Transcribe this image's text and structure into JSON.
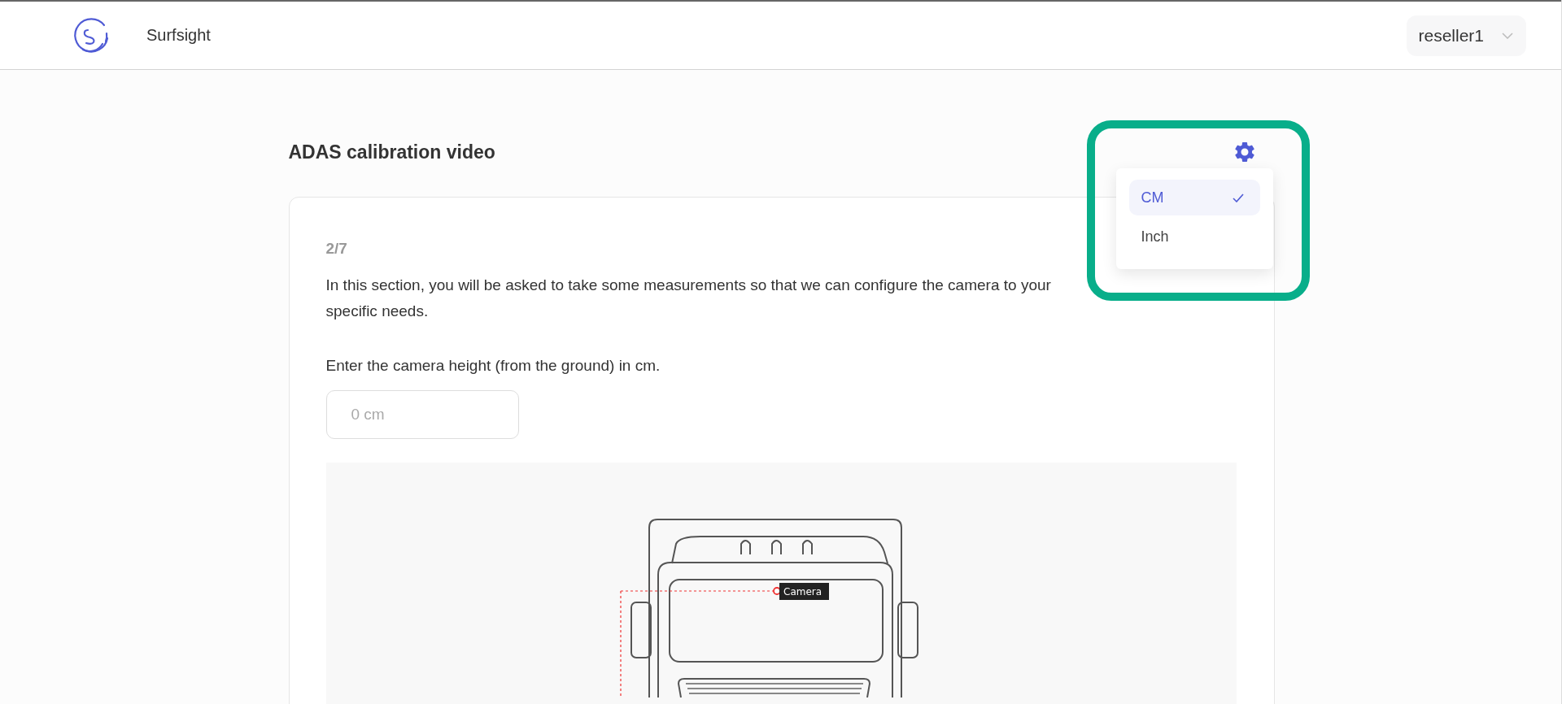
{
  "header": {
    "brand": "Surfsight",
    "account": "reseller1"
  },
  "page": {
    "title": "ADAS calibration video"
  },
  "units_menu": {
    "options": [
      {
        "label": "CM",
        "selected": true
      },
      {
        "label": "Inch",
        "selected": false
      }
    ]
  },
  "card": {
    "step": "2/7",
    "intro": "In this section, you will be asked to take some measurements so that we can configure the camera to your specific needs.",
    "prompt": "Enter the camera height (from the ground) in cm.",
    "height_field": {
      "placeholder": "0 cm"
    },
    "diagram": {
      "camera_label": "Camera"
    }
  }
}
